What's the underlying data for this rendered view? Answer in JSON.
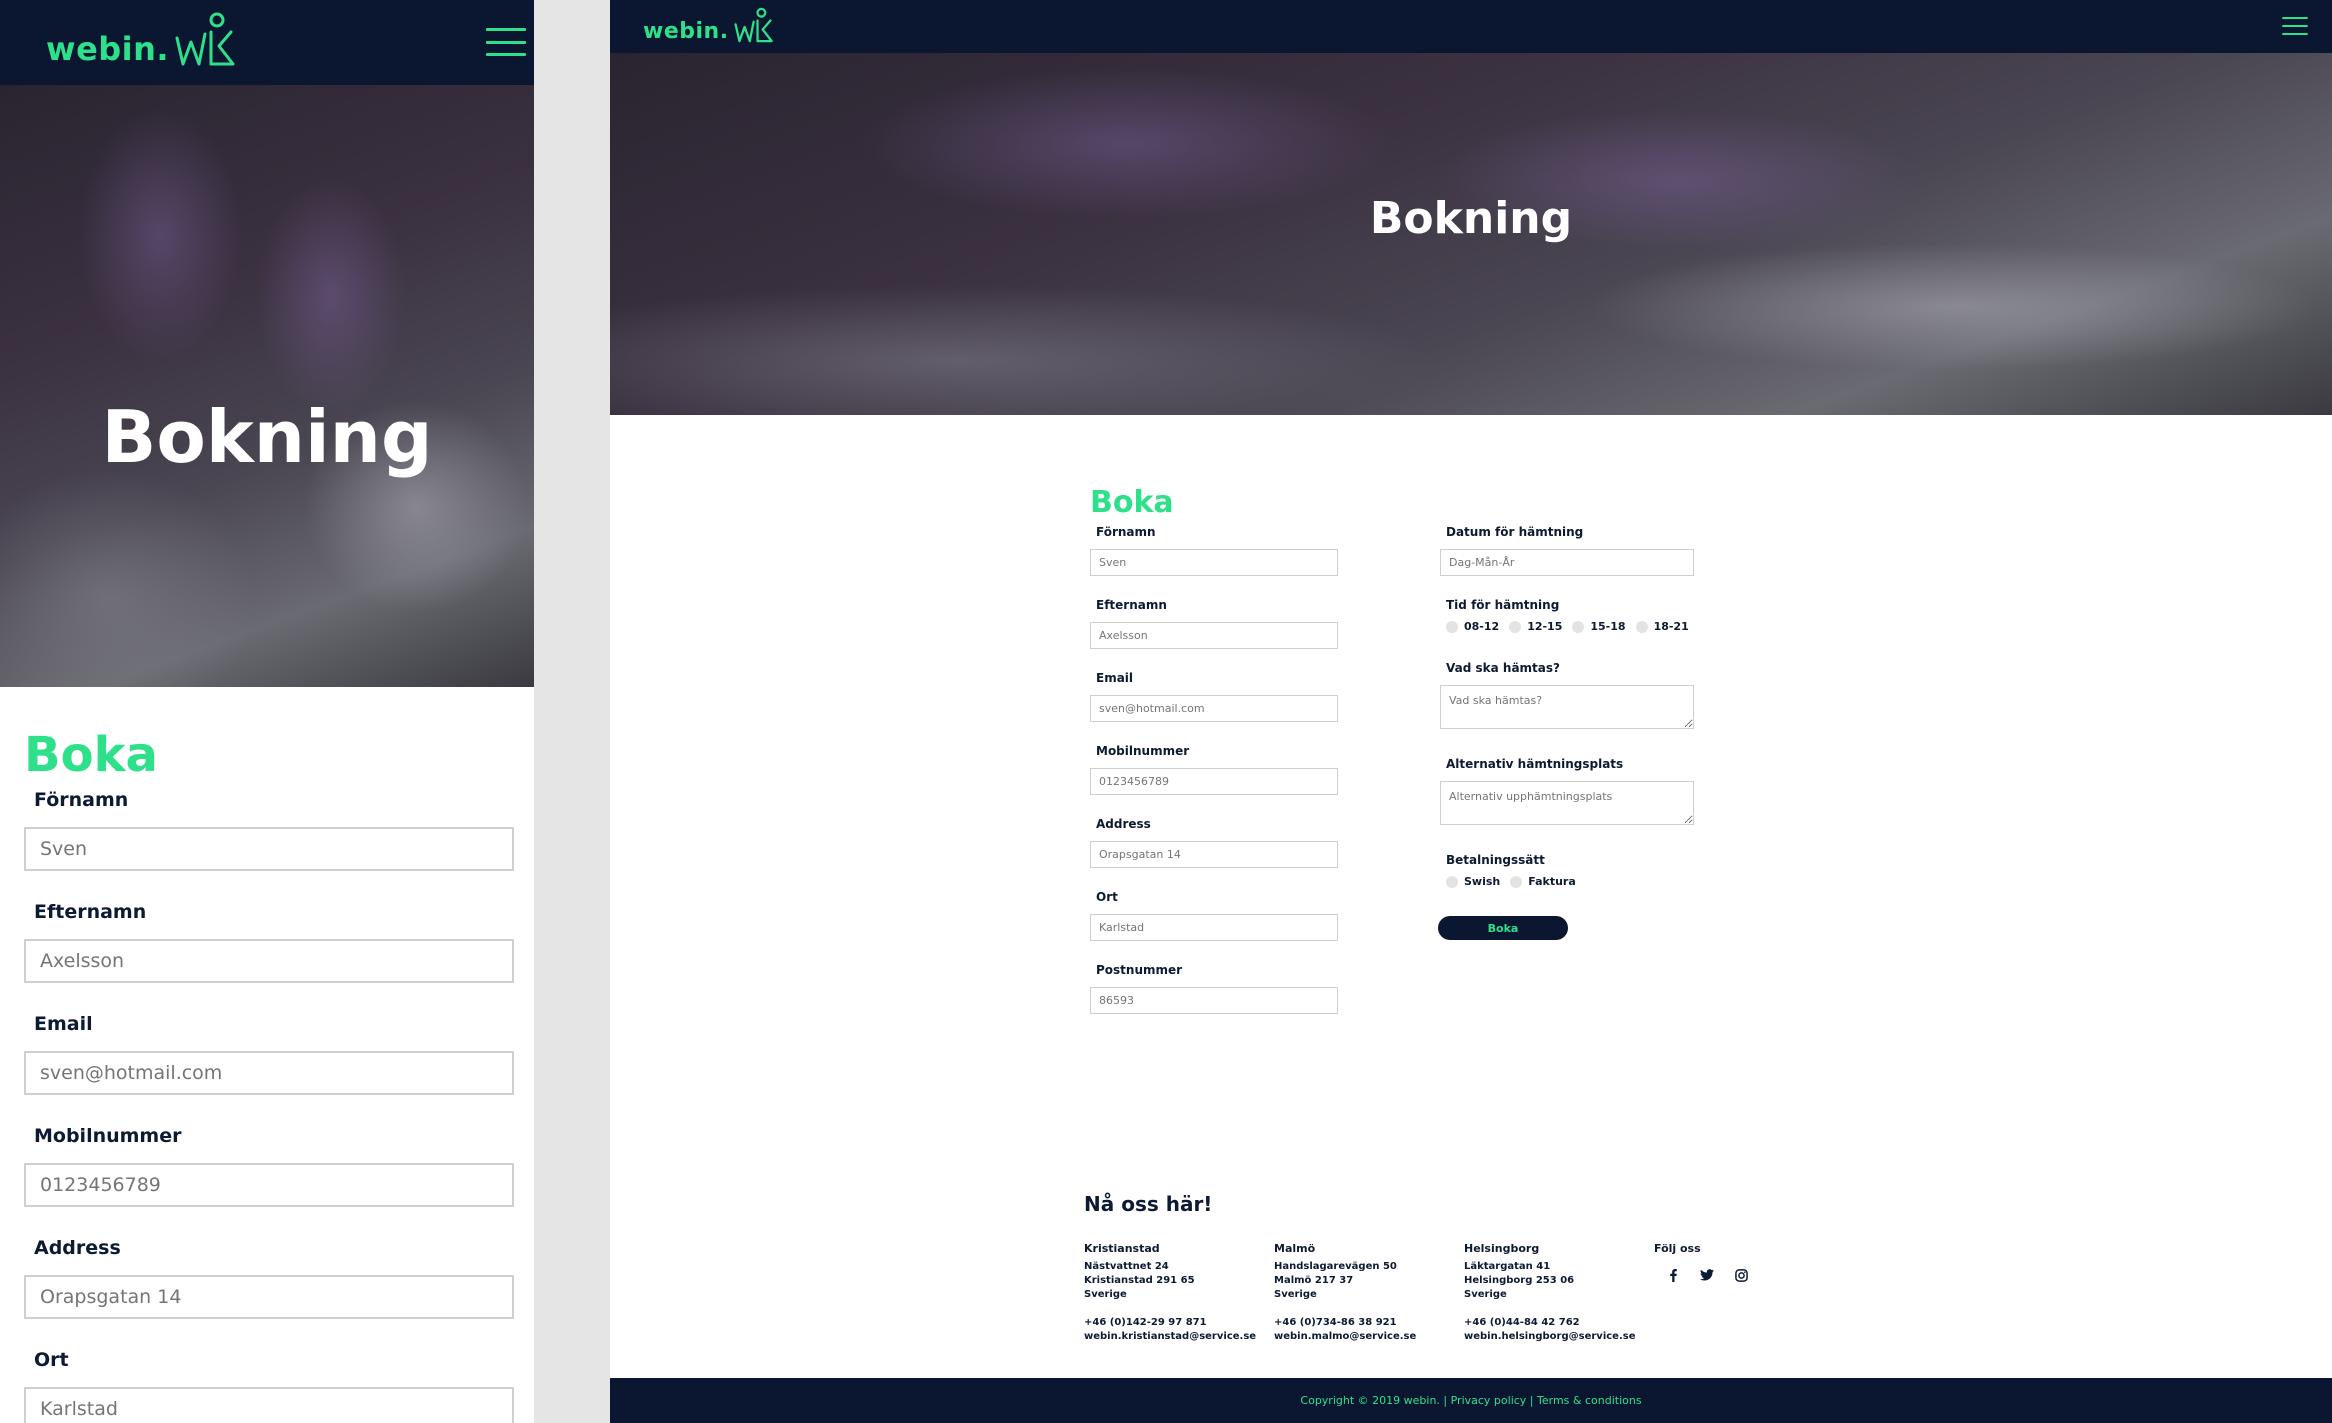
{
  "brand": {
    "logo_text": "webin.",
    "accent": "#2ee08a",
    "navy": "#0b1631"
  },
  "hero": {
    "title": "Bokning"
  },
  "form": {
    "heading": "Boka",
    "fornamn": {
      "label": "Förnamn",
      "placeholder": "Sven"
    },
    "efternamn": {
      "label": "Efternamn",
      "placeholder": "Axelsson"
    },
    "email": {
      "label": "Email",
      "placeholder": "sven@hotmail.com"
    },
    "mobil": {
      "label": "Mobilnummer",
      "placeholder": "0123456789"
    },
    "address": {
      "label": "Address",
      "placeholder": "Orapsgatan 14"
    },
    "ort": {
      "label": "Ort",
      "placeholder": "Karlstad"
    },
    "postnummer": {
      "label": "Postnummer",
      "placeholder": "86593"
    },
    "datum": {
      "label": "Datum för hämtning",
      "placeholder": "Dag-Mån-År"
    },
    "tid": {
      "label": "Tid för hämtning",
      "options": [
        "08-12",
        "12-15",
        "15-18",
        "18-21"
      ]
    },
    "vad": {
      "label": "Vad ska hämtas?",
      "placeholder": "Vad ska hämtas?"
    },
    "alternativ": {
      "label": "Alternativ hämtningsplats",
      "placeholder": "Alternativ upphämtningsplats"
    },
    "betalning": {
      "label": "Betalningssätt",
      "options": [
        "Swish",
        "Faktura"
      ]
    },
    "submit": "Boka"
  },
  "contact": {
    "heading": "Nå oss här!",
    "offices": [
      {
        "city": "Kristianstad",
        "street": "Nästvattnet 24",
        "postal": "Kristianstad 291 65",
        "country": "Sverige",
        "phone": "+46 (0)142-29 97 871",
        "email": "webin.kristianstad@service.se"
      },
      {
        "city": "Malmö",
        "street": "Handslagarevägen 50",
        "postal": "Malmö 217 37",
        "country": "Sverige",
        "phone": "+46 (0)734-86 38 921",
        "email": "webin.malmo@service.se"
      },
      {
        "city": "Helsingborg",
        "street": "Läktargatan 41",
        "postal": "Helsingborg 253 06",
        "country": "Sverige",
        "phone": "+46 (0)44-84 42 762",
        "email": "webin.helsingborg@service.se"
      }
    ],
    "follow_heading": "Följ oss",
    "social_icons": [
      "facebook-icon",
      "twitter-icon",
      "instagram-icon"
    ]
  },
  "footer": {
    "text": "Copyright © 2019 webin. | Privacy policy | Terms & conditions"
  }
}
